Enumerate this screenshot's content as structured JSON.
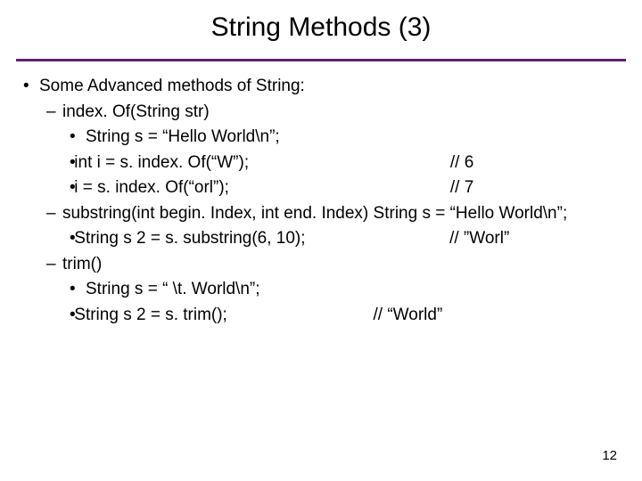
{
  "title": "String Methods (3)",
  "footer": "12",
  "b1_intro": "Some Advanced methods of String:",
  "m1": {
    "sig": "index. Of(String str)",
    "l1": "String s = “Hello World\\n”;",
    "l2": "int i = s. index. Of(“W”);",
    "l2c": "// 6",
    "l3": "i = s. index. Of(“orl”);",
    "l3c": "// 7"
  },
  "m2": {
    "sig": "substring(int begin. Index, int end. Index) String s = “Hello World\\n”;",
    "l1": "String s 2 = s. substring(6, 10);",
    "l1c": "// ”Worl”"
  },
  "m3": {
    "sig": "trim()",
    "l1": "String s = “   \\t. World\\n”;",
    "l2": "String s 2 = s. trim();",
    "l2c": "// “World”"
  }
}
